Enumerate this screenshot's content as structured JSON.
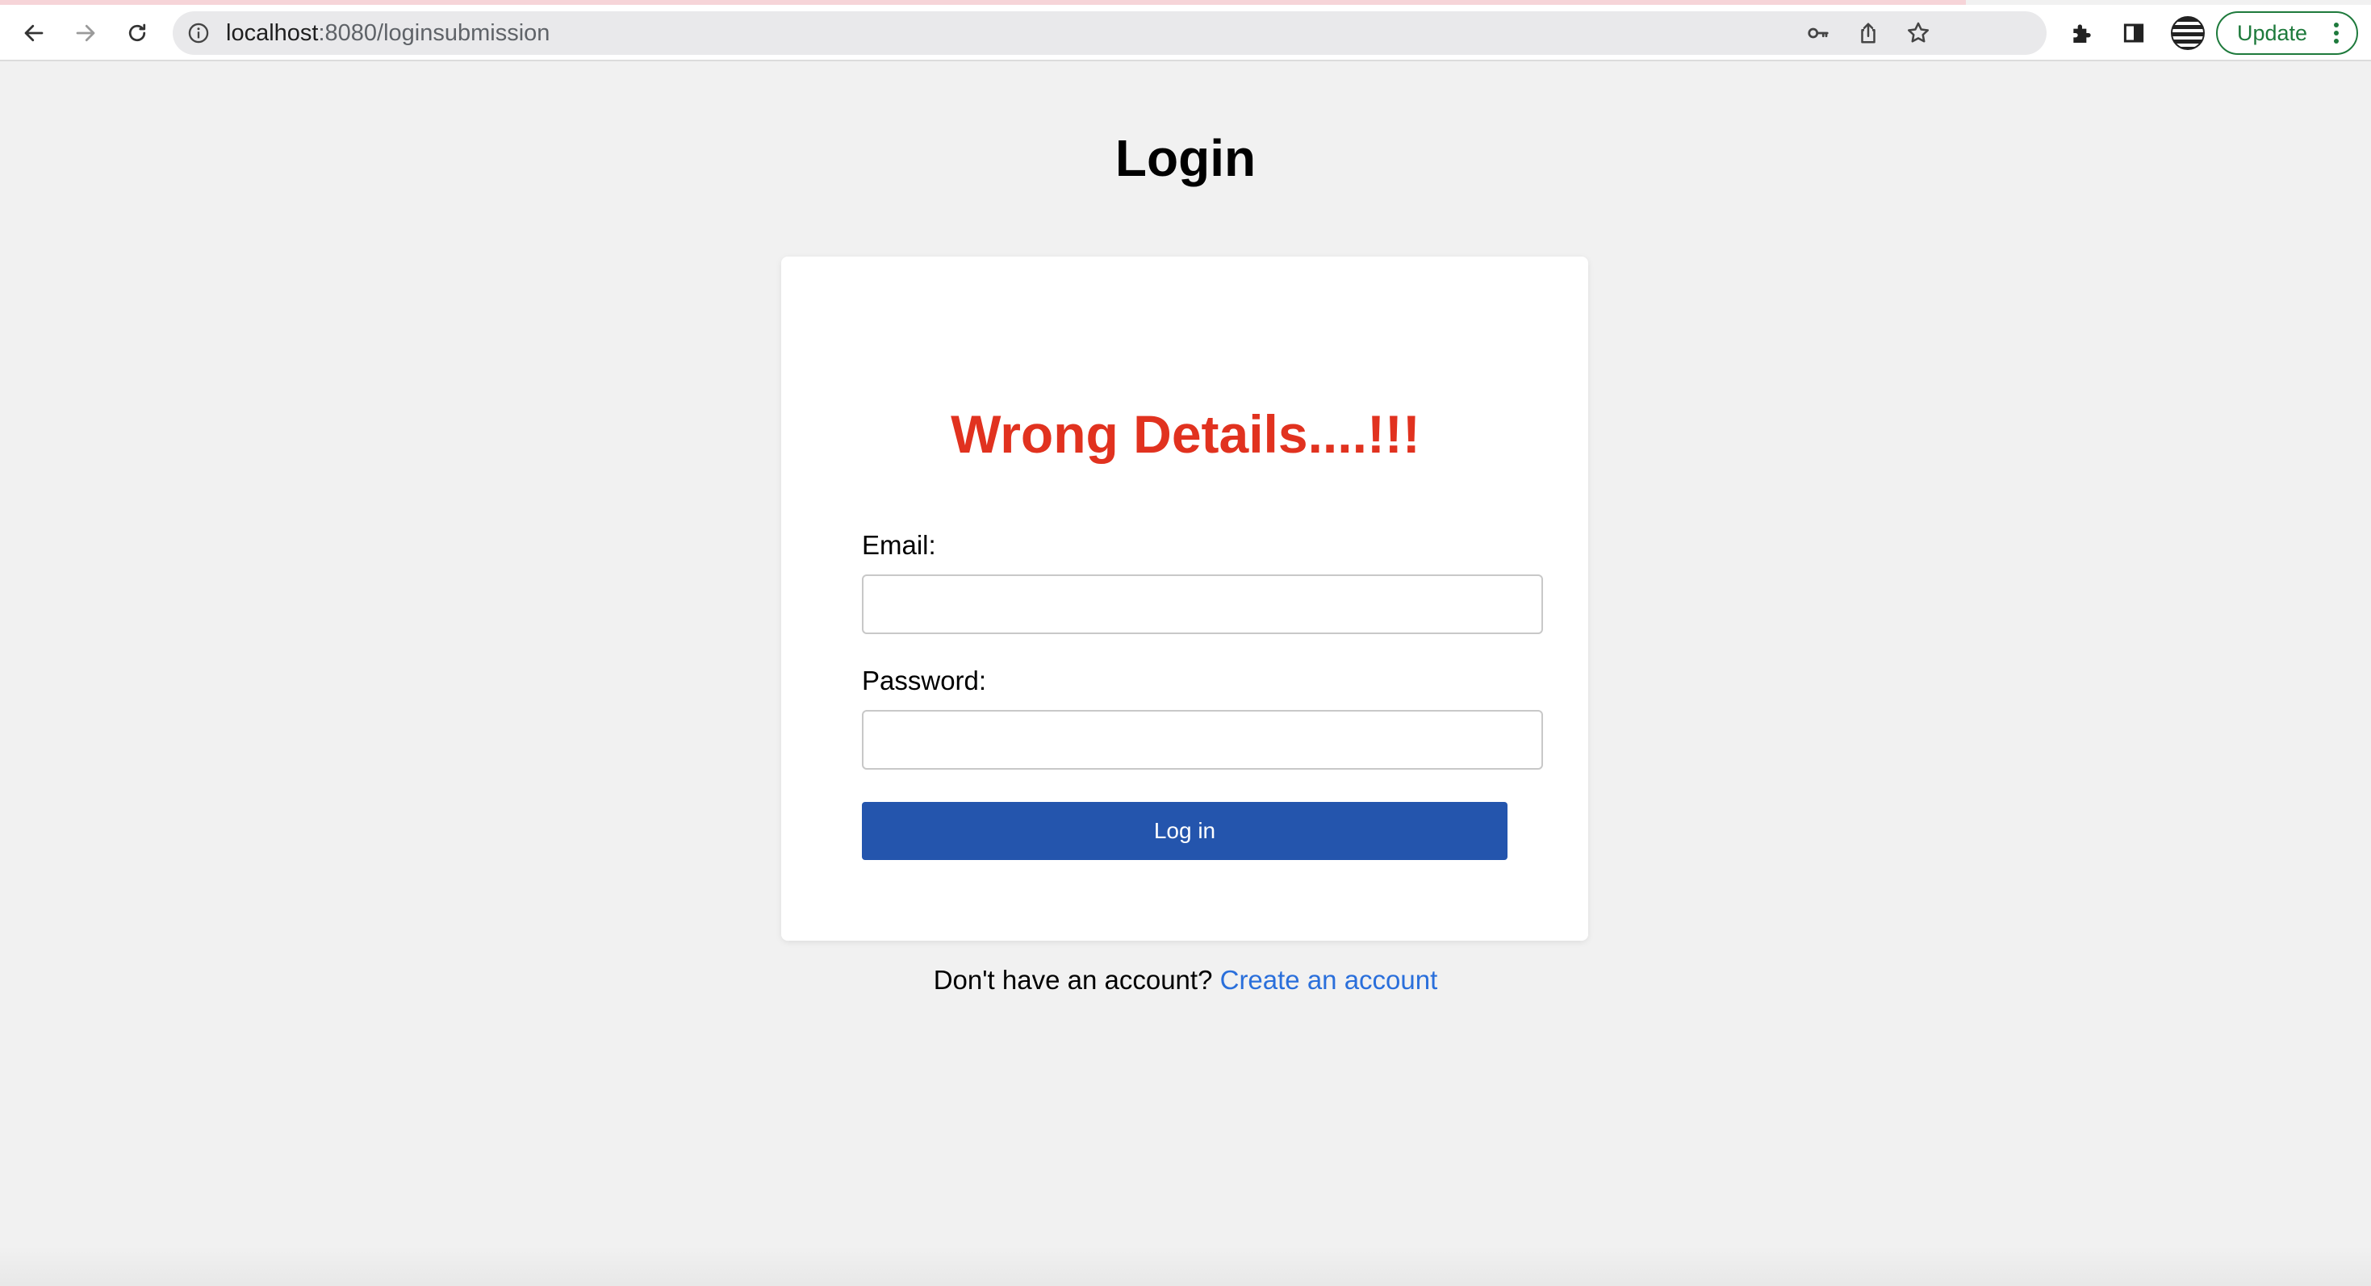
{
  "browser": {
    "url_host": "localhost",
    "url_path": ":8080/loginsubmission",
    "update_label": "Update",
    "icons": {
      "back": "back-arrow-icon",
      "forward": "forward-arrow-icon",
      "reload": "reload-icon",
      "site_info": "info-icon",
      "password_key": "key-icon",
      "share": "share-icon",
      "bookmark": "star-icon",
      "extensions": "puzzle-icon",
      "side_panel": "side-panel-icon",
      "menu": "kebab-menu-icon"
    }
  },
  "page": {
    "title": "Login",
    "error_message": "Wrong Details....!!!",
    "form": {
      "email_label": "Email:",
      "email_value": "",
      "password_label": "Password:",
      "password_value": "",
      "submit_label": "Log in"
    },
    "footer": {
      "prompt": "Don't have an account?",
      "link_label": "Create an account"
    }
  },
  "colors": {
    "page_background": "#f1f1f1",
    "error": "#e1321f",
    "primary_button": "#2455ad",
    "link": "#2a6fdb",
    "update_green": "#1e7a3c"
  }
}
